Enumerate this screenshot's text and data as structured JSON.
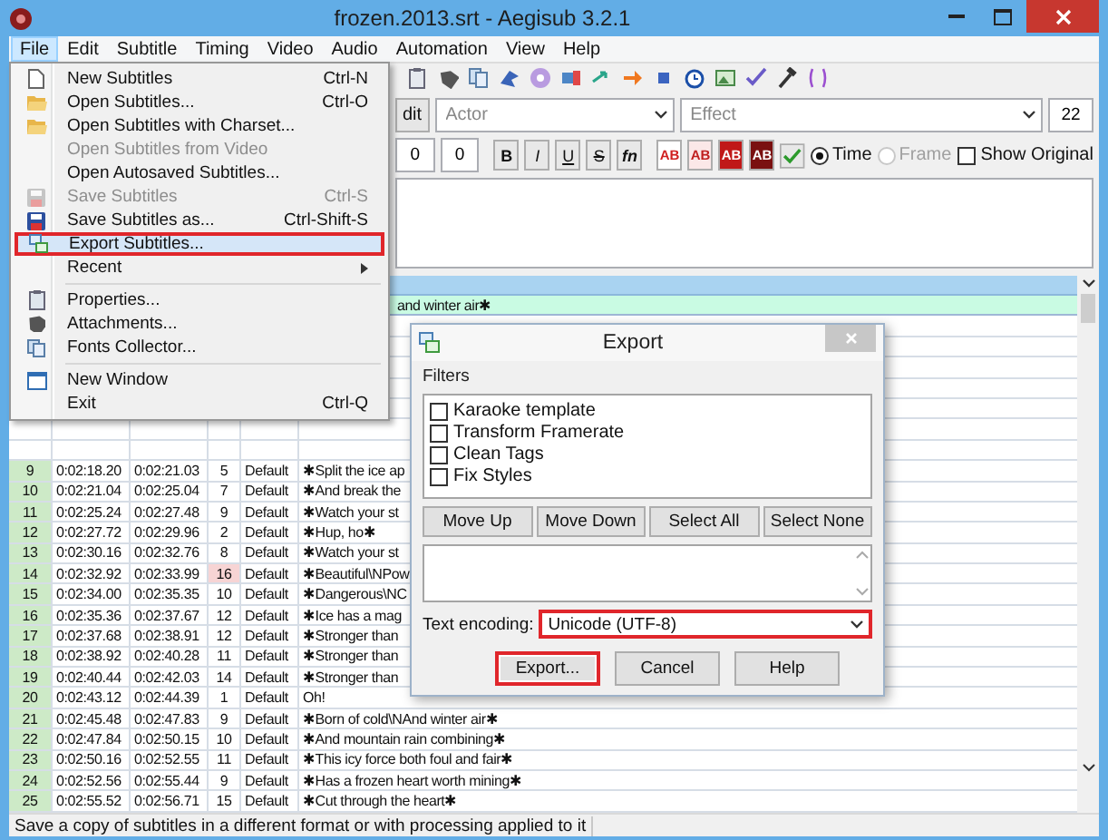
{
  "window": {
    "title": "frozen.2013.srt - Aegisub 3.2.1"
  },
  "menubar": [
    {
      "label": "File",
      "selected": true
    },
    {
      "label": "Edit",
      "selected": false
    },
    {
      "label": "Subtitle",
      "selected": false
    },
    {
      "label": "Timing",
      "selected": false
    },
    {
      "label": "Video",
      "selected": false
    },
    {
      "label": "Audio",
      "selected": false
    },
    {
      "label": "Automation",
      "selected": false
    },
    {
      "label": "View",
      "selected": false
    },
    {
      "label": "Help",
      "selected": false
    }
  ],
  "file_menu": [
    {
      "kind": "item",
      "label": "New Subtitles",
      "shortcut": "Ctrl-N",
      "disabled": false,
      "selected": false,
      "highlighted": false
    },
    {
      "kind": "item",
      "label": "Open Subtitles...",
      "shortcut": "Ctrl-O",
      "disabled": false,
      "selected": false,
      "highlighted": false
    },
    {
      "kind": "item",
      "label": "Open Subtitles with Charset...",
      "disabled": false,
      "selected": false,
      "highlighted": false
    },
    {
      "kind": "item",
      "label": "Open Subtitles from Video",
      "disabled": true,
      "selected": false,
      "highlighted": false
    },
    {
      "kind": "item",
      "label": "Open Autosaved Subtitles...",
      "disabled": false,
      "selected": false,
      "highlighted": false
    },
    {
      "kind": "item",
      "label": "Save Subtitles",
      "shortcut": "Ctrl-S",
      "disabled": true,
      "selected": false,
      "highlighted": false
    },
    {
      "kind": "item",
      "label": "Save Subtitles as...",
      "shortcut": "Ctrl-Shift-S",
      "disabled": false,
      "selected": false,
      "highlighted": false
    },
    {
      "kind": "item",
      "label": "Export Subtitles...",
      "disabled": false,
      "selected": true,
      "highlighted": true
    },
    {
      "kind": "submenu",
      "label": "Recent",
      "disabled": false,
      "selected": false,
      "highlighted": false
    },
    {
      "kind": "separator"
    },
    {
      "kind": "item",
      "label": "Properties...",
      "disabled": false,
      "selected": false,
      "highlighted": false
    },
    {
      "kind": "item",
      "label": "Attachments...",
      "disabled": false,
      "selected": false,
      "highlighted": false
    },
    {
      "kind": "item",
      "label": "Fonts Collector...",
      "disabled": false,
      "selected": false,
      "highlighted": false
    },
    {
      "kind": "separator"
    },
    {
      "kind": "item",
      "label": "New Window",
      "disabled": false,
      "selected": false,
      "highlighted": false
    },
    {
      "kind": "item",
      "label": "Exit",
      "shortcut": "Ctrl-Q",
      "disabled": false,
      "selected": false,
      "highlighted": false
    }
  ],
  "edit_box": {
    "edit_button": "dit",
    "actor": {
      "placeholder": "Actor"
    },
    "effect": {
      "placeholder": "Effect"
    },
    "layer": "22",
    "margins": [
      "0",
      "0"
    ],
    "format_buttons": [
      "B",
      "I",
      "U",
      "S",
      "fn"
    ],
    "color_buttons": [
      "AB",
      "AB",
      "AB",
      "AB"
    ],
    "time_modes": [
      {
        "label": "Time",
        "selected": true,
        "disabled": false
      },
      {
        "label": "Frame",
        "selected": false,
        "disabled": true
      }
    ],
    "show_original": {
      "label": "Show Original",
      "checked": false
    }
  },
  "grid": {
    "rows": [
      {
        "text": "and winter air✱",
        "active": true
      },
      {
        "active": false
      },
      {
        "active": false
      },
      {
        "active": false
      },
      {
        "active": false
      },
      {
        "active": false
      },
      {
        "active": false
      },
      {
        "active": false
      },
      {
        "number": "9",
        "start": "0:02:18.20",
        "end": "0:02:21.03",
        "cps": "5",
        "style": "Default",
        "text": "✱Split the ice ap",
        "active": false,
        "cps_high": false
      },
      {
        "number": "10",
        "start": "0:02:21.04",
        "end": "0:02:25.04",
        "cps": "7",
        "style": "Default",
        "text": "✱And break the",
        "active": false,
        "cps_high": false
      },
      {
        "number": "11",
        "start": "0:02:25.24",
        "end": "0:02:27.48",
        "cps": "9",
        "style": "Default",
        "text": "✱Watch your st",
        "active": false,
        "cps_high": false
      },
      {
        "number": "12",
        "start": "0:02:27.72",
        "end": "0:02:29.96",
        "cps": "2",
        "style": "Default",
        "text": "✱Hup, ho✱",
        "active": false,
        "cps_high": false
      },
      {
        "number": "13",
        "start": "0:02:30.16",
        "end": "0:02:32.76",
        "cps": "8",
        "style": "Default",
        "text": "✱Watch your st",
        "active": false,
        "cps_high": false
      },
      {
        "number": "14",
        "start": "0:02:32.92",
        "end": "0:02:33.99",
        "cps": "16",
        "style": "Default",
        "text": "✱Beautiful\\NPow",
        "active": false,
        "cps_high": true
      },
      {
        "number": "15",
        "start": "0:02:34.00",
        "end": "0:02:35.35",
        "cps": "10",
        "style": "Default",
        "text": "✱Dangerous\\NC",
        "active": false,
        "cps_high": false
      },
      {
        "number": "16",
        "start": "0:02:35.36",
        "end": "0:02:37.67",
        "cps": "12",
        "style": "Default",
        "text": "✱Ice has a mag",
        "active": false,
        "cps_high": false
      },
      {
        "number": "17",
        "start": "0:02:37.68",
        "end": "0:02:38.91",
        "cps": "12",
        "style": "Default",
        "text": "✱Stronger than",
        "active": false,
        "cps_high": false
      },
      {
        "number": "18",
        "start": "0:02:38.92",
        "end": "0:02:40.28",
        "cps": "11",
        "style": "Default",
        "text": "✱Stronger than",
        "active": false,
        "cps_high": false
      },
      {
        "number": "19",
        "start": "0:02:40.44",
        "end": "0:02:42.03",
        "cps": "14",
        "style": "Default",
        "text": "✱Stronger than",
        "active": false,
        "cps_high": false
      },
      {
        "number": "20",
        "start": "0:02:43.12",
        "end": "0:02:44.39",
        "cps": "1",
        "style": "Default",
        "text": "Oh!",
        "active": false,
        "cps_high": false
      },
      {
        "number": "21",
        "start": "0:02:45.48",
        "end": "0:02:47.83",
        "cps": "9",
        "style": "Default",
        "text": "✱Born of cold\\NAnd winter air✱",
        "active": false,
        "cps_high": false
      },
      {
        "number": "22",
        "start": "0:02:47.84",
        "end": "0:02:50.15",
        "cps": "10",
        "style": "Default",
        "text": "✱And mountain rain combining✱",
        "active": false,
        "cps_high": false
      },
      {
        "number": "23",
        "start": "0:02:50.16",
        "end": "0:02:52.55",
        "cps": "11",
        "style": "Default",
        "text": "✱This icy force both foul and fair✱",
        "active": false,
        "cps_high": false
      },
      {
        "number": "24",
        "start": "0:02:52.56",
        "end": "0:02:55.44",
        "cps": "9",
        "style": "Default",
        "text": "✱Has a frozen heart worth mining✱",
        "active": false,
        "cps_high": false
      },
      {
        "number": "25",
        "start": "0:02:55.52",
        "end": "0:02:56.71",
        "cps": "15",
        "style": "Default",
        "text": "✱Cut through the heart✱",
        "active": false,
        "cps_high": false
      }
    ]
  },
  "export_dialog": {
    "title": "Export",
    "filters_label": "Filters",
    "filters": [
      {
        "label": "Karaoke template",
        "checked": false
      },
      {
        "label": "Transform Framerate",
        "checked": false
      },
      {
        "label": "Clean Tags",
        "checked": false
      },
      {
        "label": "Fix Styles",
        "checked": false
      }
    ],
    "list_buttons": [
      {
        "label": "Move Up"
      },
      {
        "label": "Move Down"
      },
      {
        "label": "Select All"
      },
      {
        "label": "Select None"
      }
    ],
    "encoding": {
      "label": "Text encoding:",
      "value": "Unicode (UTF-8)",
      "highlighted": true
    },
    "buttons": [
      {
        "label": "Export...",
        "highlighted": true
      },
      {
        "label": "Cancel",
        "highlighted": false
      },
      {
        "label": "Help",
        "highlighted": false
      }
    ]
  },
  "status_bar": {
    "text": "Save a copy of subtitles in a different format or with processing applied to it"
  }
}
